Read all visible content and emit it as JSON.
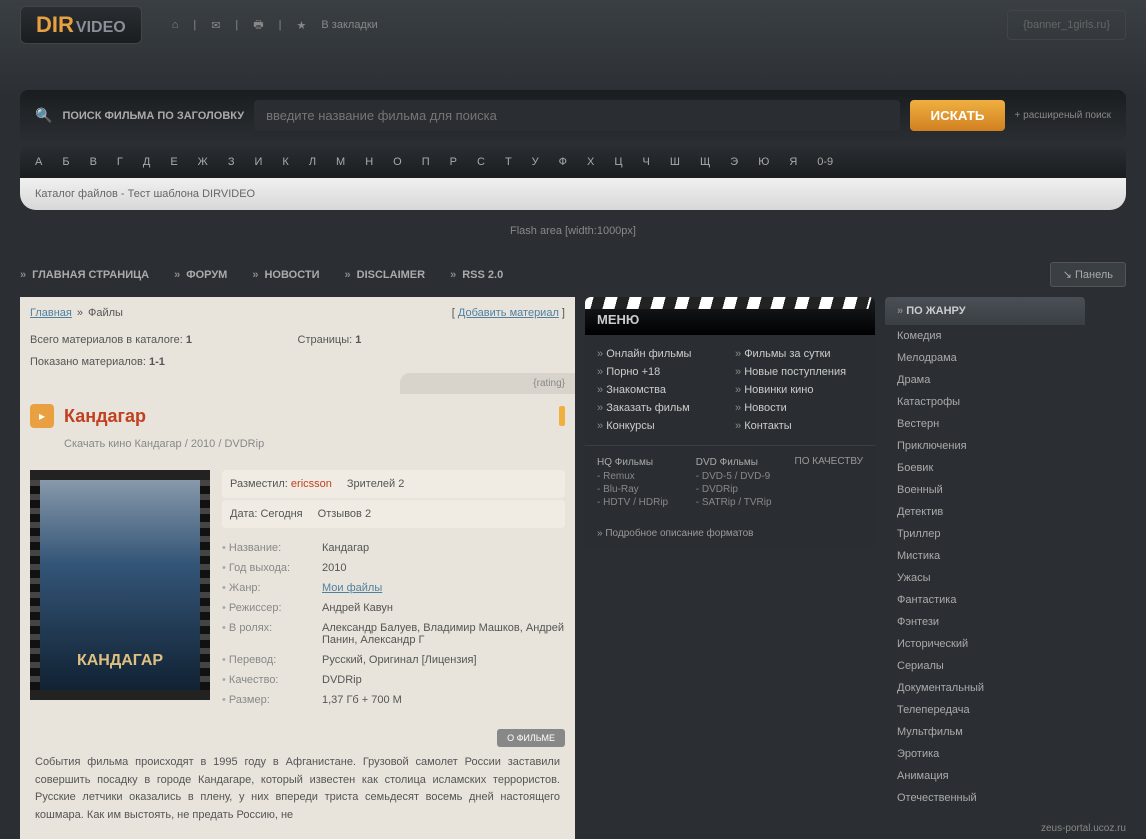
{
  "logo": {
    "dir": "DIR",
    "video": "VIDEO"
  },
  "topbar": {
    "bookmark": "В закладки"
  },
  "banner_placeholder": "{banner_1girls.ru}",
  "search": {
    "label": "ПОИСК ФИЛЬМА ПО ЗАГОЛОВКУ",
    "placeholder": "введите название фильма для поиска",
    "button": "ИСКАТЬ",
    "advanced": "+ расширеный поиск"
  },
  "alphabet": [
    "А",
    "Б",
    "В",
    "Г",
    "Д",
    "Е",
    "Ж",
    "З",
    "И",
    "К",
    "Л",
    "М",
    "Н",
    "О",
    "П",
    "Р",
    "С",
    "Т",
    "У",
    "Ф",
    "Х",
    "Ц",
    "Ч",
    "Ш",
    "Щ",
    "Э",
    "Ю",
    "Я",
    "0-9"
  ],
  "subtitle": "Каталог файлов - Тест шаблона DIRVIDEO",
  "flash": "Flash area [width:1000px]",
  "nav": [
    "ГЛАВНАЯ СТРАНИЦА",
    "ФОРУМ",
    "НОВОСТИ",
    "DISCLAIMER",
    "RSS 2.0"
  ],
  "panel": "Панель",
  "breadcrumb": {
    "home": "Главная",
    "sep": "»",
    "files": "Файлы",
    "add": "Добавить материал"
  },
  "catalog": {
    "total_lbl": "Всего материалов в каталоге:",
    "total": "1",
    "shown_lbl": "Показано материалов:",
    "shown": "1-1",
    "pages_lbl": "Страницы:",
    "pages": "1"
  },
  "rating": "{rating}",
  "film": {
    "title": "Кандагар",
    "sub": "Скачать кино Кандагар / 2010 / DVDRip",
    "poster_title": "КАНДАГАР",
    "posted_lbl": "Разместил:",
    "posted_by": "ericsson",
    "views_lbl": "Зрителей 2",
    "date_lbl": "Дата:",
    "date": "Сегодня",
    "reviews": "Отзывов 2",
    "fields": [
      {
        "label": "Название:",
        "value": "Кандагар"
      },
      {
        "label": "Год выхода:",
        "value": "2010"
      },
      {
        "label": "Жанр:",
        "value": "Мои файлы",
        "link": true
      },
      {
        "label": "Режиссер:",
        "value": "Андрей Кавун"
      },
      {
        "label": "В ролях:",
        "value": "Александр Балуев, Владимир Машков, Андрей Панин, Александр Г"
      },
      {
        "label": "Перевод:",
        "value": "Русский, Оригинал [Лицензия]"
      },
      {
        "label": "Качество:",
        "value": "DVDRip"
      },
      {
        "label": "Размер:",
        "value": "1,37 Гб + 700 М"
      }
    ],
    "about_tab": "О ФИЛЬМЕ",
    "desc": "События фильма происходят в 1995 году в Афганистане. Грузовой самолет России заставили совершить посадку в городе Кандагаре, который известен как столица исламских террористов. Русские летчики оказались в плену, у них впереди триста семьдесят восемь дней настоящего кошмара. Как им выстоять, не предать Россию, не"
  },
  "menu": {
    "title": "МЕНЮ",
    "col1": [
      "Онлайн фильмы",
      "Порно +18",
      "Знакомства",
      "Заказать фильм",
      "Конкурсы"
    ],
    "col2": [
      "Фильмы за сутки",
      "Новые поступления",
      "Новинки кино",
      "Новости",
      "Контакты"
    ],
    "quality_title": "ПО КАЧЕСТВУ",
    "hq_title": "HQ Фильмы",
    "hq": [
      "- Remux",
      "- Blu-Ray",
      "- HDTV / HDRip"
    ],
    "dvd_title": "DVD Фильмы",
    "dvd": [
      "- DVD-5 / DVD-9",
      "- DVDRip",
      "- SATRip / TVRip"
    ],
    "more": "Подробное описание форматов"
  },
  "genres": {
    "title": "ПО ЖАНРУ",
    "items": [
      "Комедия",
      "Мелодрама",
      "Драма",
      "Катастрофы",
      "Вестерн",
      "Приключения",
      "Боевик",
      "Военный",
      "Детектив",
      "Триллер",
      "Мистика",
      "Ужасы",
      "Фантастика",
      "Фэнтези",
      "Исторический",
      "Сериалы",
      "Документальный",
      "Телепередача",
      "Мультфильм",
      "Эротика",
      "Анимация",
      "Отечественный"
    ]
  },
  "footer": "zeus-portal.ucoz.ru"
}
